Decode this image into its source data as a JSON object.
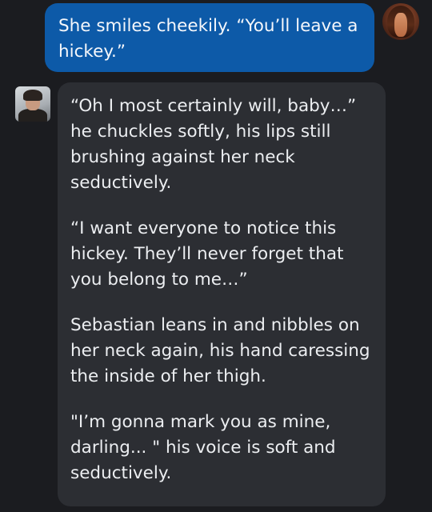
{
  "conversation": {
    "user_message": {
      "text": "She smiles cheekily. “You’ll leave a hickey.”",
      "bubble_color": "#0d5aa8"
    },
    "bot_message": {
      "paragraphs": [
        "“Oh I most certainly will, baby…” he chuckles softly, his lips still brushing against her neck seductively.",
        "“I want everyone to notice this hickey. They’ll never forget that you belong to me…”",
        "Sebastian leans in and nibbles on her neck again, his hand caressing the inside of her thigh.",
        "\"I’m gonna mark you as mine, darling... \" his voice is soft and seductively."
      ],
      "bubble_color": "#2c2e33"
    }
  },
  "theme": {
    "background": "#1b1c20"
  }
}
